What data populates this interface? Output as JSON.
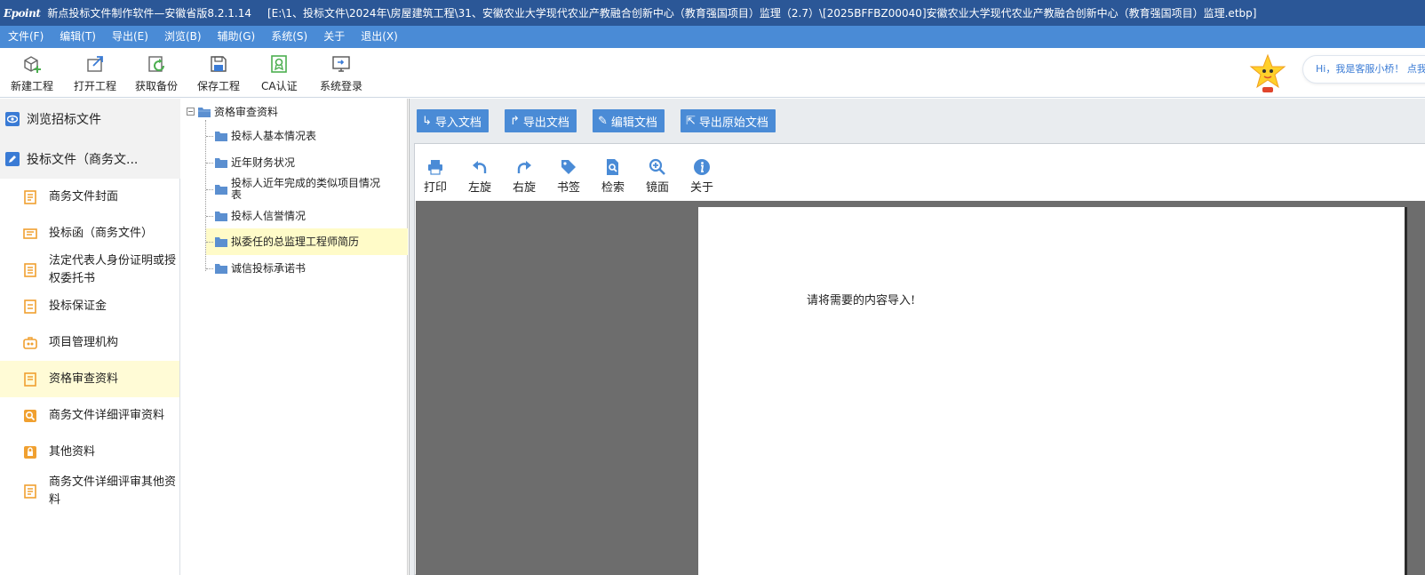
{
  "titlebar": {
    "logo": "Epoint",
    "app_title": "新点投标文件制作软件—安徽省版8.2.1.14",
    "file_path": "[E:\\1、投标文件\\2024年\\房屋建筑工程\\31、安徽农业大学现代农业产教融合创新中心（教育强国项目）监理（2.7）\\[2025BFFBZ00040]安徽农业大学现代农业产教融合创新中心（教育强国项目）监理.etbp]"
  },
  "menu": {
    "items": [
      "文件(F)",
      "编辑(T)",
      "导出(E)",
      "浏览(B)",
      "辅助(G)",
      "系统(S)",
      "关于",
      "退出(X)"
    ]
  },
  "toolbar": {
    "buttons": [
      {
        "label": "新建工程",
        "icon": "new-project-icon"
      },
      {
        "label": "打开工程",
        "icon": "open-project-icon"
      },
      {
        "label": "获取备份",
        "icon": "get-backup-icon"
      },
      {
        "label": "保存工程",
        "icon": "save-icon"
      },
      {
        "label": "CA认证",
        "icon": "ca-certificate-icon"
      },
      {
        "label": "系统登录",
        "icon": "system-login-icon"
      }
    ],
    "assistant_greeting": "Hi，我是客服小桥！ 点我"
  },
  "leftnav": {
    "browse_label": "浏览招标文件",
    "bid_label": "投标文件（商务文...",
    "items": [
      {
        "label": "商务文件封面",
        "icon": "document-icon"
      },
      {
        "label": "投标函（商务文件）",
        "icon": "letter-icon"
      },
      {
        "label": "法定代表人身份证明或授权委托书",
        "icon": "id-card-icon"
      },
      {
        "label": "投标保证金",
        "icon": "deposit-icon"
      },
      {
        "label": "项目管理机构",
        "icon": "organization-icon"
      },
      {
        "label": "资格审查资料",
        "icon": "document-icon"
      },
      {
        "label": "商务文件详细评审资料",
        "icon": "search-icon"
      },
      {
        "label": "其他资料",
        "icon": "lock-icon"
      },
      {
        "label": "商务文件详细评审其他资料",
        "icon": "document-icon"
      }
    ]
  },
  "tree": {
    "root_label": "资格审查资料",
    "nodes": [
      "投标人基本情况表",
      "近年财务状况",
      "投标人近年完成的类似项目情况表",
      "投标人信誉情况",
      "拟委任的总监理工程师简历",
      "诚信投标承诺书"
    ]
  },
  "docbar": {
    "buttons": [
      "导入文档",
      "导出文档",
      "编辑文档",
      "导出原始文档"
    ]
  },
  "viewer": {
    "tools": [
      "打印",
      "左旋",
      "右旋",
      "书签",
      "检索",
      "镜面",
      "关于"
    ],
    "message": "请将需要的内容导入!"
  },
  "colors": {
    "titlebar": "#2b5797",
    "menubar": "#4a8bd6",
    "accent": "#4a8bd6",
    "nav_icon_orange": "#f0a030",
    "active_bg": "#fffbd6",
    "folder_blue": "#5b8fd0",
    "viewer_bg": "#6d6d6d"
  }
}
